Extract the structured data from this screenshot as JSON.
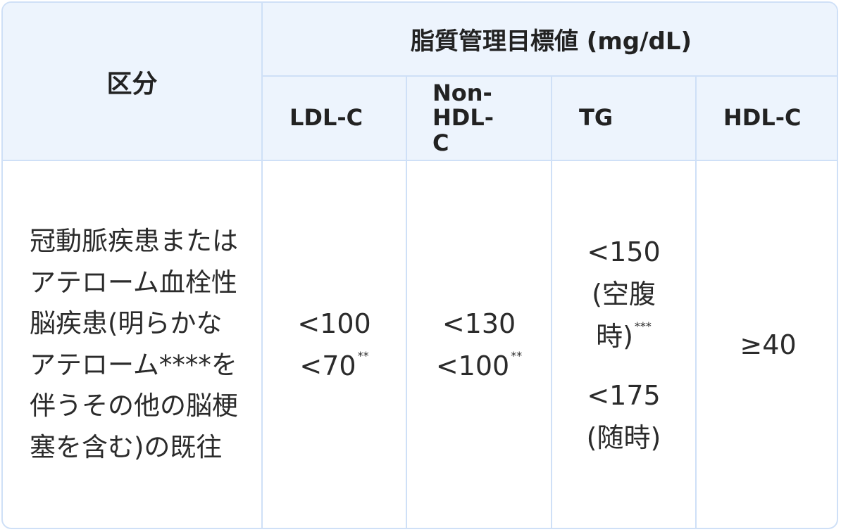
{
  "header": {
    "category": "区分",
    "group": "脂質管理目標値 (mg/dL)",
    "ldl": "LDL-C",
    "nonhdl": "Non-HDL-C",
    "tg": "TG",
    "hdl": "HDL-C"
  },
  "row": {
    "category": "冠動脈疾患またはアテローム血栓性脳疾患(明らかなアテローム****を伴うその他の脳梗塞を含む)の既往",
    "ldl_1": "<100",
    "ldl_2": "<70",
    "ldl_2_mark": "**",
    "nonhdl_1": "<130",
    "nonhdl_2": "<100",
    "nonhdl_2_mark": "**",
    "tg_1": "<150",
    "tg_1_note": "(空腹時)",
    "tg_1_mark": "***",
    "tg_2": "<175",
    "tg_2_note": "(随時)",
    "hdl": "≥40"
  }
}
